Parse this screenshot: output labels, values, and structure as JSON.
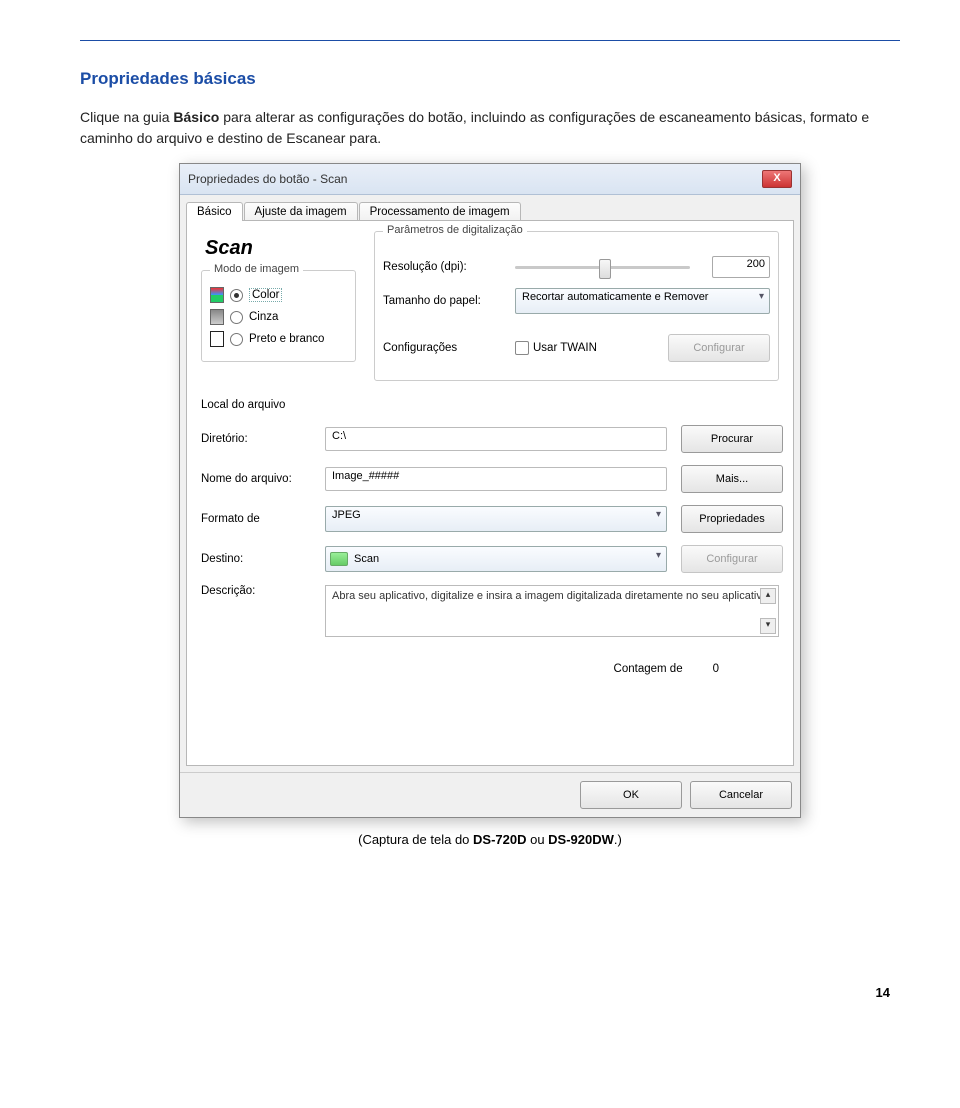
{
  "page": {
    "heading": "Propriedades básicas",
    "body_prefix": "Clique na guia ",
    "body_bold": "Básico",
    "body_suffix": " para alterar as configurações do botão, incluindo as configurações de escaneamento básicas, formato e caminho do arquivo e destino de Escanear para.",
    "caption_prefix": "(Captura de tela do ",
    "caption_bold1": "DS-720D",
    "caption_mid": " ou ",
    "caption_bold2": "DS-920DW",
    "caption_end": ".)",
    "number": "14"
  },
  "dialog": {
    "title": "Propriedades do botão - Scan",
    "close": "X",
    "tabs": [
      "Básico",
      "Ajuste da imagem",
      "Processamento de imagem"
    ],
    "scan_title": "Scan",
    "image_mode": {
      "legend": "Modo de imagem",
      "options": [
        "Color",
        "Cinza",
        "Preto e branco"
      ],
      "selected": 0
    },
    "params": {
      "legend": "Parâmetros de digitalização",
      "resolution_label": "Resolução (dpi):",
      "resolution_value": "200",
      "paper_label": "Tamanho do papel:",
      "paper_value": "Recortar automaticamente e Remover",
      "config_label": "Configurações",
      "twain_label": "Usar TWAIN",
      "config_btn": "Configurar"
    },
    "file": {
      "section": "Local do arquivo",
      "dir_label": "Diretório:",
      "dir_value": "C:\\",
      "browse_btn": "Procurar",
      "name_label": "Nome do arquivo:",
      "name_value": "Image_#####",
      "more_btn": "Mais...",
      "format_label": "Formato de",
      "format_value": "JPEG",
      "props_btn": "Propriedades",
      "dest_label": "Destino:",
      "dest_value": "Scan",
      "dest_cfg_btn": "Configurar",
      "desc_label": "Descrição:",
      "desc_value": "Abra seu aplicativo, digitalize e insira a imagem digitalizada diretamente no seu aplicativo."
    },
    "count_label": "Contagem de",
    "count_value": "0",
    "ok": "OK",
    "cancel": "Cancelar"
  }
}
